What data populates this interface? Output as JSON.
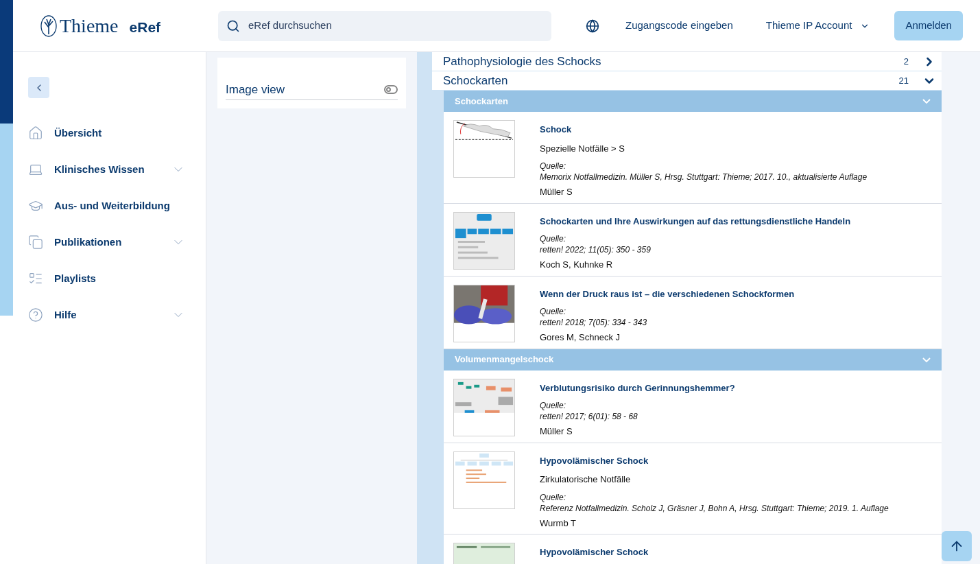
{
  "header": {
    "logo": "Thieme",
    "product": "eRef",
    "search": {
      "placeholder": "eRef durchsuchen"
    },
    "links": [
      "Zugangscode eingeben",
      "Thieme IP Account"
    ],
    "login": "Anmelden"
  },
  "sidebar": {
    "items": [
      {
        "label": "Übersicht",
        "expandable": false
      },
      {
        "label": "Klinisches Wissen",
        "expandable": true
      },
      {
        "label": "Aus- und Weiterbildung",
        "expandable": false
      },
      {
        "label": "Publikationen",
        "expandable": true
      },
      {
        "label": "Playlists",
        "expandable": false
      },
      {
        "label": "Hilfe",
        "expandable": true
      }
    ]
  },
  "filter": {
    "label": "Image view",
    "on": false
  },
  "sections": [
    {
      "title": "Pathophysiologie des Schocks",
      "count": "2",
      "expanded": false
    },
    {
      "title": "Schockarten",
      "count": "21",
      "expanded": true,
      "groups": [
        {
          "title": "Schockarten",
          "expanded": true,
          "items": [
            {
              "title": "Schock",
              "category": "Spezielle Notfälle > S",
              "source_label": "Quelle:",
              "source": "Memorix Notfallmedizin. Müller S, Hrsg. Stuttgart: Thieme; 2017. 10., aktualisierte Auflage",
              "authors": "Müller S"
            },
            {
              "title": "Schockarten und Ihre Auswirkungen auf das rettungsdienstliche Handeln",
              "source_label": "Quelle:",
              "source": "retten! 2022; 11(05): 350 - 359",
              "authors": "Koch S, Kuhnke R"
            },
            {
              "title": "Wenn der Druck raus ist – die verschiedenen Schockformen",
              "source_label": "Quelle:",
              "source": "retten! 2018; 7(05): 334 - 343",
              "authors": "Gores M, Schneck J"
            }
          ]
        },
        {
          "title": "Volumenmangelschock",
          "expanded": true,
          "items": [
            {
              "title": "Verblutungsrisiko durch Gerinnungshemmer?",
              "source_label": "Quelle:",
              "source": "retten! 2017; 6(01): 58 - 68",
              "authors": "Müller S"
            },
            {
              "title": "Hypovolämischer Schock",
              "category": "Zirkulatorische Notfälle",
              "source_label": "Quelle:",
              "source": "Referenz Notfallmedizin. Scholz J, Gräsner J, Bohn A, Hrsg. Stuttgart: Thieme; 2019. 1. Auflage",
              "authors": "Wurmb T"
            },
            {
              "title": "Hypovolämischer Schock"
            }
          ]
        }
      ]
    }
  ]
}
